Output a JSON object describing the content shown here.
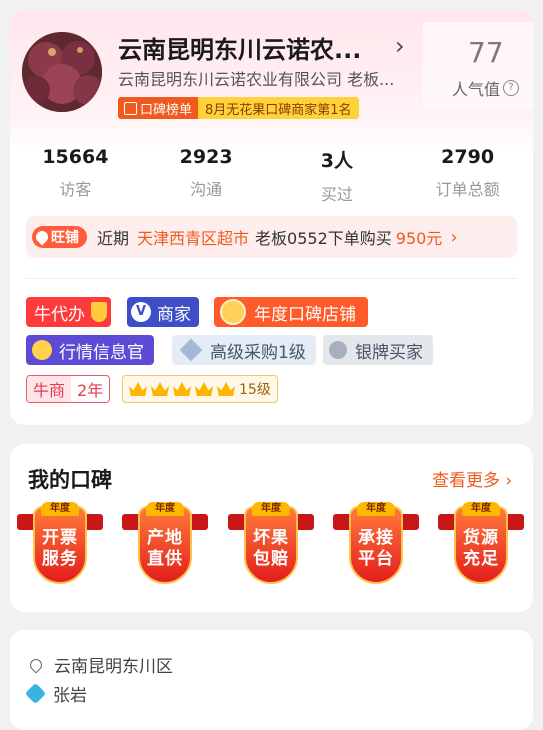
{
  "shop": {
    "name": "云南昆明东川云诺农...",
    "company": "云南昆明东川云诺农业有限公司  老板...",
    "rank_badge_left": "口碑榜单",
    "rank_badge_right": "8月无花果口碑商家第1名",
    "popularity_value": "77",
    "popularity_label": "人气值"
  },
  "stats": [
    {
      "value": "15664",
      "label": "访客"
    },
    {
      "value": "2923",
      "label": "沟通"
    },
    {
      "value": "3人",
      "label": "买过"
    },
    {
      "value": "2790",
      "label": "订单总额"
    }
  ],
  "recent": {
    "badge": "旺铺",
    "prefix": "近期",
    "location": "天津西青区超市",
    "middle": "老板0552下单购买",
    "amount": "950元"
  },
  "tags": {
    "agent": "牛代办",
    "merchant_v": "V",
    "merchant": "商家",
    "annual": "年度口碑店铺",
    "market": "行情信息官",
    "senior": "高级采购1级",
    "silver": "银牌买家",
    "niu_a": "牛商",
    "niu_b": "2年",
    "level": "15级"
  },
  "reputation": {
    "title": "我的口碑",
    "see_more": "查看更多",
    "badge_top": "年度",
    "badges": [
      {
        "line1": "开票",
        "line2": "服务"
      },
      {
        "line1": "产地",
        "line2": "直供"
      },
      {
        "line1": "坏果",
        "line2": "包赔"
      },
      {
        "line1": "承接",
        "line2": "平台"
      },
      {
        "line1": "货源",
        "line2": "充足"
      }
    ]
  },
  "address": {
    "location": "云南昆明东川区",
    "contact": "张岩"
  }
}
